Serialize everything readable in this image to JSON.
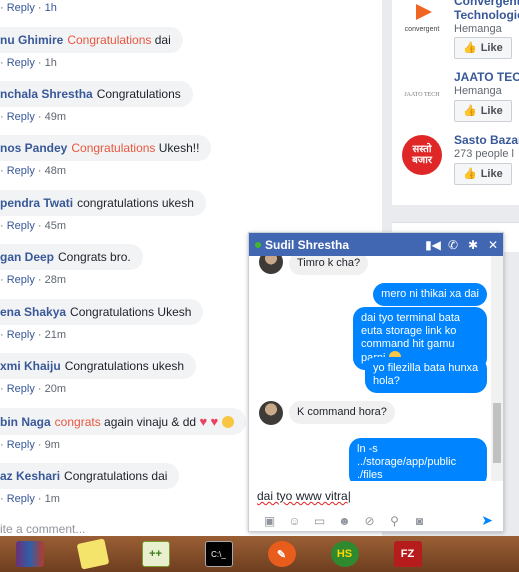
{
  "comments": [
    {
      "author": "",
      "text": "",
      "reply": "Reply",
      "time": "1h",
      "partial_first_meta": "· Reply · 1h"
    },
    {
      "author": "nu Ghimire",
      "highlight": "Congratulations",
      "text": " dai",
      "reply": "Reply",
      "time": "1h"
    },
    {
      "author": "nchala Shrestha",
      "highlight": "",
      "text": "Congratulations",
      "reply": "Reply",
      "time": "49m"
    },
    {
      "author": "nos Pandey",
      "highlight": "Congratulations",
      "text": " Ukesh!!",
      "reply": "Reply",
      "time": "48m"
    },
    {
      "author": "pendra Twati",
      "highlight": "",
      "text": "congratulations ukesh",
      "reply": "Reply",
      "time": "45m"
    },
    {
      "author": "gan Deep",
      "highlight": "",
      "text": "Congrats bro.",
      "reply": "Reply",
      "time": "28m"
    },
    {
      "author": "ena Shakya",
      "highlight": "",
      "text": "Congratulations Ukesh",
      "reply": "Reply",
      "time": "21m"
    },
    {
      "author": "xmi Khaiju",
      "highlight": "",
      "text": "Congratulations ukesh",
      "reply": "Reply",
      "time": "20m"
    },
    {
      "author": "bin Naga",
      "highlight": "congrats",
      "text": " again vinaju & dd",
      "reply": "Reply",
      "time": "9m"
    },
    {
      "author": "az Keshari",
      "highlight": "",
      "text": "Congratulations dai",
      "reply": "Reply",
      "time": "1m"
    }
  ],
  "write_comment": "ite a comment...",
  "pages": [
    {
      "name": "Convergent Technologie",
      "sub": "Hemanga",
      "like": "Like",
      "logo_text": "convergent"
    },
    {
      "name": "JAATO TEC",
      "sub": "Hemanga",
      "like": "Like",
      "logo_text": "JAATO TECH"
    },
    {
      "name": "Sasto Bazar",
      "sub": "273 people l",
      "like": "Like",
      "logo_text": "सस्तो बजार"
    }
  ],
  "chat": {
    "name": "Sudil Shrestha",
    "messages": [
      {
        "dir": "in",
        "text": "Timro k cha?"
      },
      {
        "dir": "out",
        "text": "mero ni thikai xa dai"
      },
      {
        "dir": "out",
        "text": "dai tyo terminal bata euta storage link ko command hit gamu parni"
      },
      {
        "dir": "out",
        "text": "yo filezilla bata hunxa hola?"
      },
      {
        "dir": "in",
        "text": "K command hora?"
      },
      {
        "dir": "out",
        "text": "ln -s ../storage/app/public ./files"
      }
    ],
    "input_value": "dai tyo www vitra"
  },
  "taskbar": [
    {
      "icon": "winrar-icon",
      "label": ""
    },
    {
      "icon": "sticky-notes-icon",
      "label": ""
    },
    {
      "icon": "notepad-plus-plus-icon",
      "label": ""
    },
    {
      "icon": "terminal-icon",
      "label": "C:\\_"
    },
    {
      "icon": "tool-icon",
      "label": ""
    },
    {
      "icon": "hs-icon",
      "label": "HS"
    },
    {
      "icon": "filezilla-icon",
      "label": "FZ"
    }
  ],
  "colors": {
    "fb_blue": "#4267b2",
    "messenger_blue": "#0084ff",
    "link": "#385898",
    "highlight": "#e9573f"
  }
}
